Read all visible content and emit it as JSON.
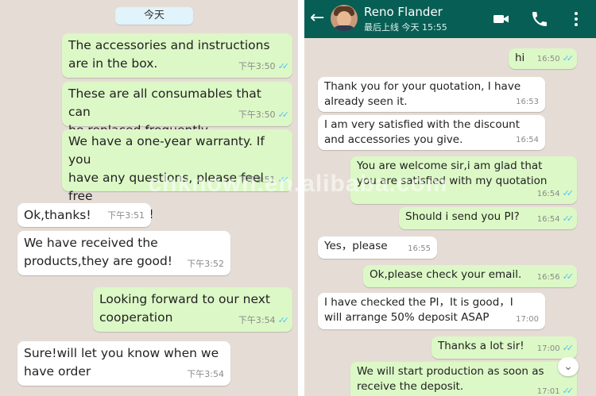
{
  "left_chat": {
    "day_label": "今天",
    "messages": [
      {
        "text": "The accessories and instructions\nare in the box.",
        "time": "下午3:50"
      },
      {
        "text": "These are all consumables that can\nbe replaced frequently.",
        "time": "下午3:50"
      },
      {
        "text": "We have a one-year warranty. If you\nhave any questions, please feel free\nto contact us!",
        "time": "下午3:51"
      },
      {
        "text": "Ok,thanks!",
        "time": "下午3:51"
      },
      {
        "text": "We have received the\nproducts,they are good!",
        "time": "下午3:52"
      },
      {
        "text": "Looking forward to our next\ncooperation",
        "time": "下午3:54"
      },
      {
        "text": "Sure!will let you know when we\nhave order",
        "time": "下午3:54"
      }
    ]
  },
  "right_chat": {
    "header": {
      "contact_name": "Reno Flander",
      "status": "最后上线 今天 15:55",
      "back_icon": "arrow-left-icon",
      "video_icon": "video-camera-icon",
      "call_icon": "phone-icon",
      "menu_icon": "more-vert-icon"
    },
    "messages": [
      {
        "text": "hi",
        "time": "16:50"
      },
      {
        "text": "Thank you for your quotation, I have\nalready seen it.",
        "time": "16:53"
      },
      {
        "text": "I am very satisfied with the discount\nand accessories you give.",
        "time": "16:54"
      },
      {
        "text": "You are welcome sir,i am glad that\nyou are satisfied with my quotation",
        "time": "16:54"
      },
      {
        "text": "Should i send you PI?",
        "time": "16:54"
      },
      {
        "text": "Yes，please",
        "time": "16:55"
      },
      {
        "text": "Ok,please check your email.",
        "time": "16:56"
      },
      {
        "text": "I have checked the PI，It is good，I\nwill arrange 50% deposit ASAP",
        "time": "17:00"
      },
      {
        "text": "Thanks a lot sir!",
        "time": "17:00"
      },
      {
        "text": "We will start production as soon as\nreceive the deposit.",
        "time": "17:01"
      }
    ]
  },
  "watermark": "chknown.en.alibaba.com",
  "colors": {
    "outgoing_bubble": "#dcf8c6",
    "incoming_bubble": "#ffffff",
    "chat_background": "#e5ddd5",
    "header": "#075e54",
    "read_tick": "#4fc3f7"
  }
}
